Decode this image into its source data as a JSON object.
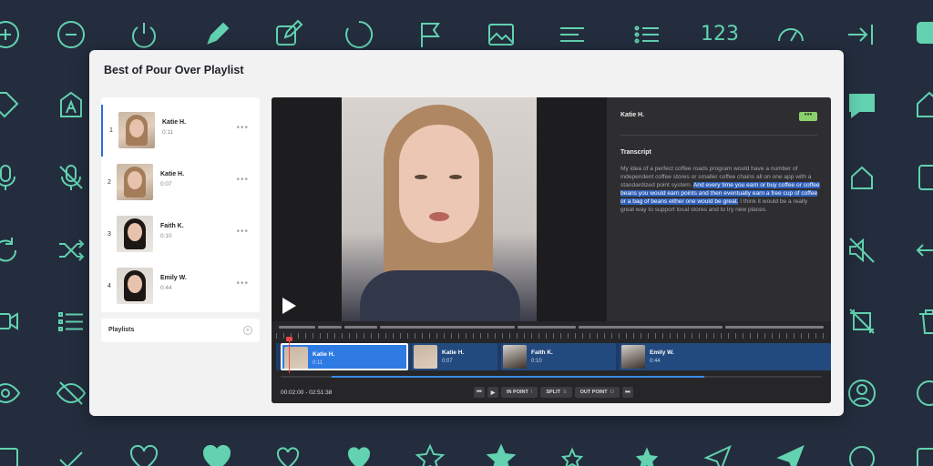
{
  "window": {
    "title": "Best of Pour Over Playlist"
  },
  "playlist": {
    "items": [
      {
        "index": "1",
        "name": "Katie H.",
        "duration": "0:11",
        "more": "•••"
      },
      {
        "index": "2",
        "name": "Katie H.",
        "duration": "0:07",
        "more": "•••"
      },
      {
        "index": "3",
        "name": "Faith K.",
        "duration": "0:10",
        "more": "•••"
      },
      {
        "index": "4",
        "name": "Emily W.",
        "duration": "0:44",
        "more": "•••"
      }
    ],
    "playlists_label": "Playlists",
    "add_symbol": "+"
  },
  "side_panel": {
    "speaker": "Katie H.",
    "more": "•••",
    "heading": "Transcript",
    "text_before": "My idea of a perfect coffee roads program would have a number of independent coffee stores or smaller coffee chains all on one app with a standardized point system. ",
    "text_highlight": "And every time you earn or buy coffee or coffee beans you would earn points and then eventually earn a free cup of coffee or a bag of beans either one would be great.",
    "text_after": " I think it would be a really great way to support local stores and to try new places."
  },
  "timeline": {
    "clips": [
      {
        "name": "Katie H.",
        "duration": "0:11"
      },
      {
        "name": "Katie H.",
        "duration": "0:07"
      },
      {
        "name": "Faith K.",
        "duration": "0:10"
      },
      {
        "name": "Emily W.",
        "duration": "0:44"
      }
    ],
    "progress": 0.76,
    "timecode": "00:02:00 - 02:51:38"
  },
  "controls": {
    "prev_icon": "skip-back-icon",
    "play_icon": "play-icon",
    "in_point": "IN POINT",
    "in_point_key": "I",
    "split": "SPLIT",
    "split_key": "S",
    "out_point": "OUT POINT",
    "out_point_key": "O",
    "next_icon": "skip-forward-icon"
  },
  "colors": {
    "background": "#232d3d",
    "icon_accent": "#62d2b0",
    "selection": "#2e7be3",
    "more_badge": "#8bd16b",
    "playhead": "#e94848"
  }
}
